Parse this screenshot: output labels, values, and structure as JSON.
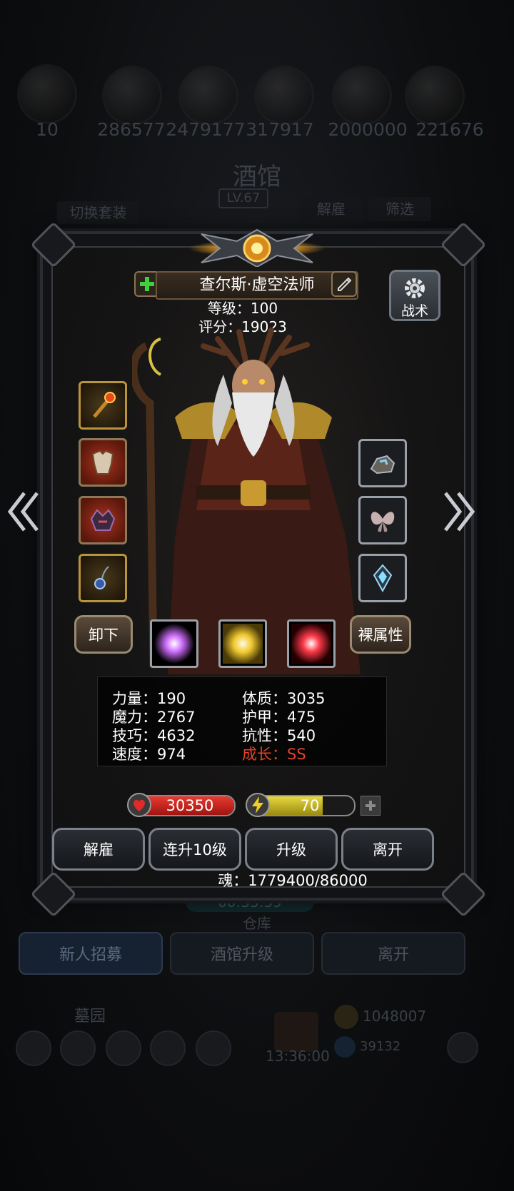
{
  "background": {
    "resources": [
      "10",
      "286577",
      "2479177",
      "317917",
      "2000000",
      "221676"
    ],
    "tavern_title": "酒馆",
    "tavern_level": "LV.67",
    "switch_set": "切换套装",
    "dismiss_top": "解雇",
    "filter": "筛选",
    "timer": "00:35:59",
    "warehouse": "仓库",
    "tabs": [
      "新人招募",
      "酒馆升级",
      "离开"
    ],
    "cemetery": "墓园",
    "gold": "1048007",
    "gems": "39132",
    "bottom_timer": "13:36:00"
  },
  "hero": {
    "name": "查尔斯·虚空法师",
    "level_label": "等级：100",
    "score_label": "评分：19023",
    "tactics_label": "战术",
    "unequip_label": "卸下",
    "base_attr_label": "裸属性"
  },
  "stats": {
    "left": [
      "力量：190",
      "魔力：2767",
      "技巧：4632",
      "速度：974"
    ],
    "right": [
      "体质：3035",
      "护甲：475",
      "抗性：540"
    ],
    "growth": "成长：SS"
  },
  "bars": {
    "hp": "30350",
    "energy": "70",
    "energy_fraction": 0.7
  },
  "actions": [
    "解雇",
    "连升10级",
    "升级",
    "离开"
  ],
  "soul": "魂：1779400/86000",
  "icons": {
    "add": "plus-icon",
    "edit": "pencil-icon",
    "gear": "gear-icon",
    "heart": "heart-icon",
    "lightning": "lightning-icon",
    "prev": "chevron-left-icon",
    "next": "chevron-right-icon"
  },
  "colors": {
    "hp": "#c8201c",
    "energy": "#d6c21c",
    "growth": "#e0442a"
  }
}
